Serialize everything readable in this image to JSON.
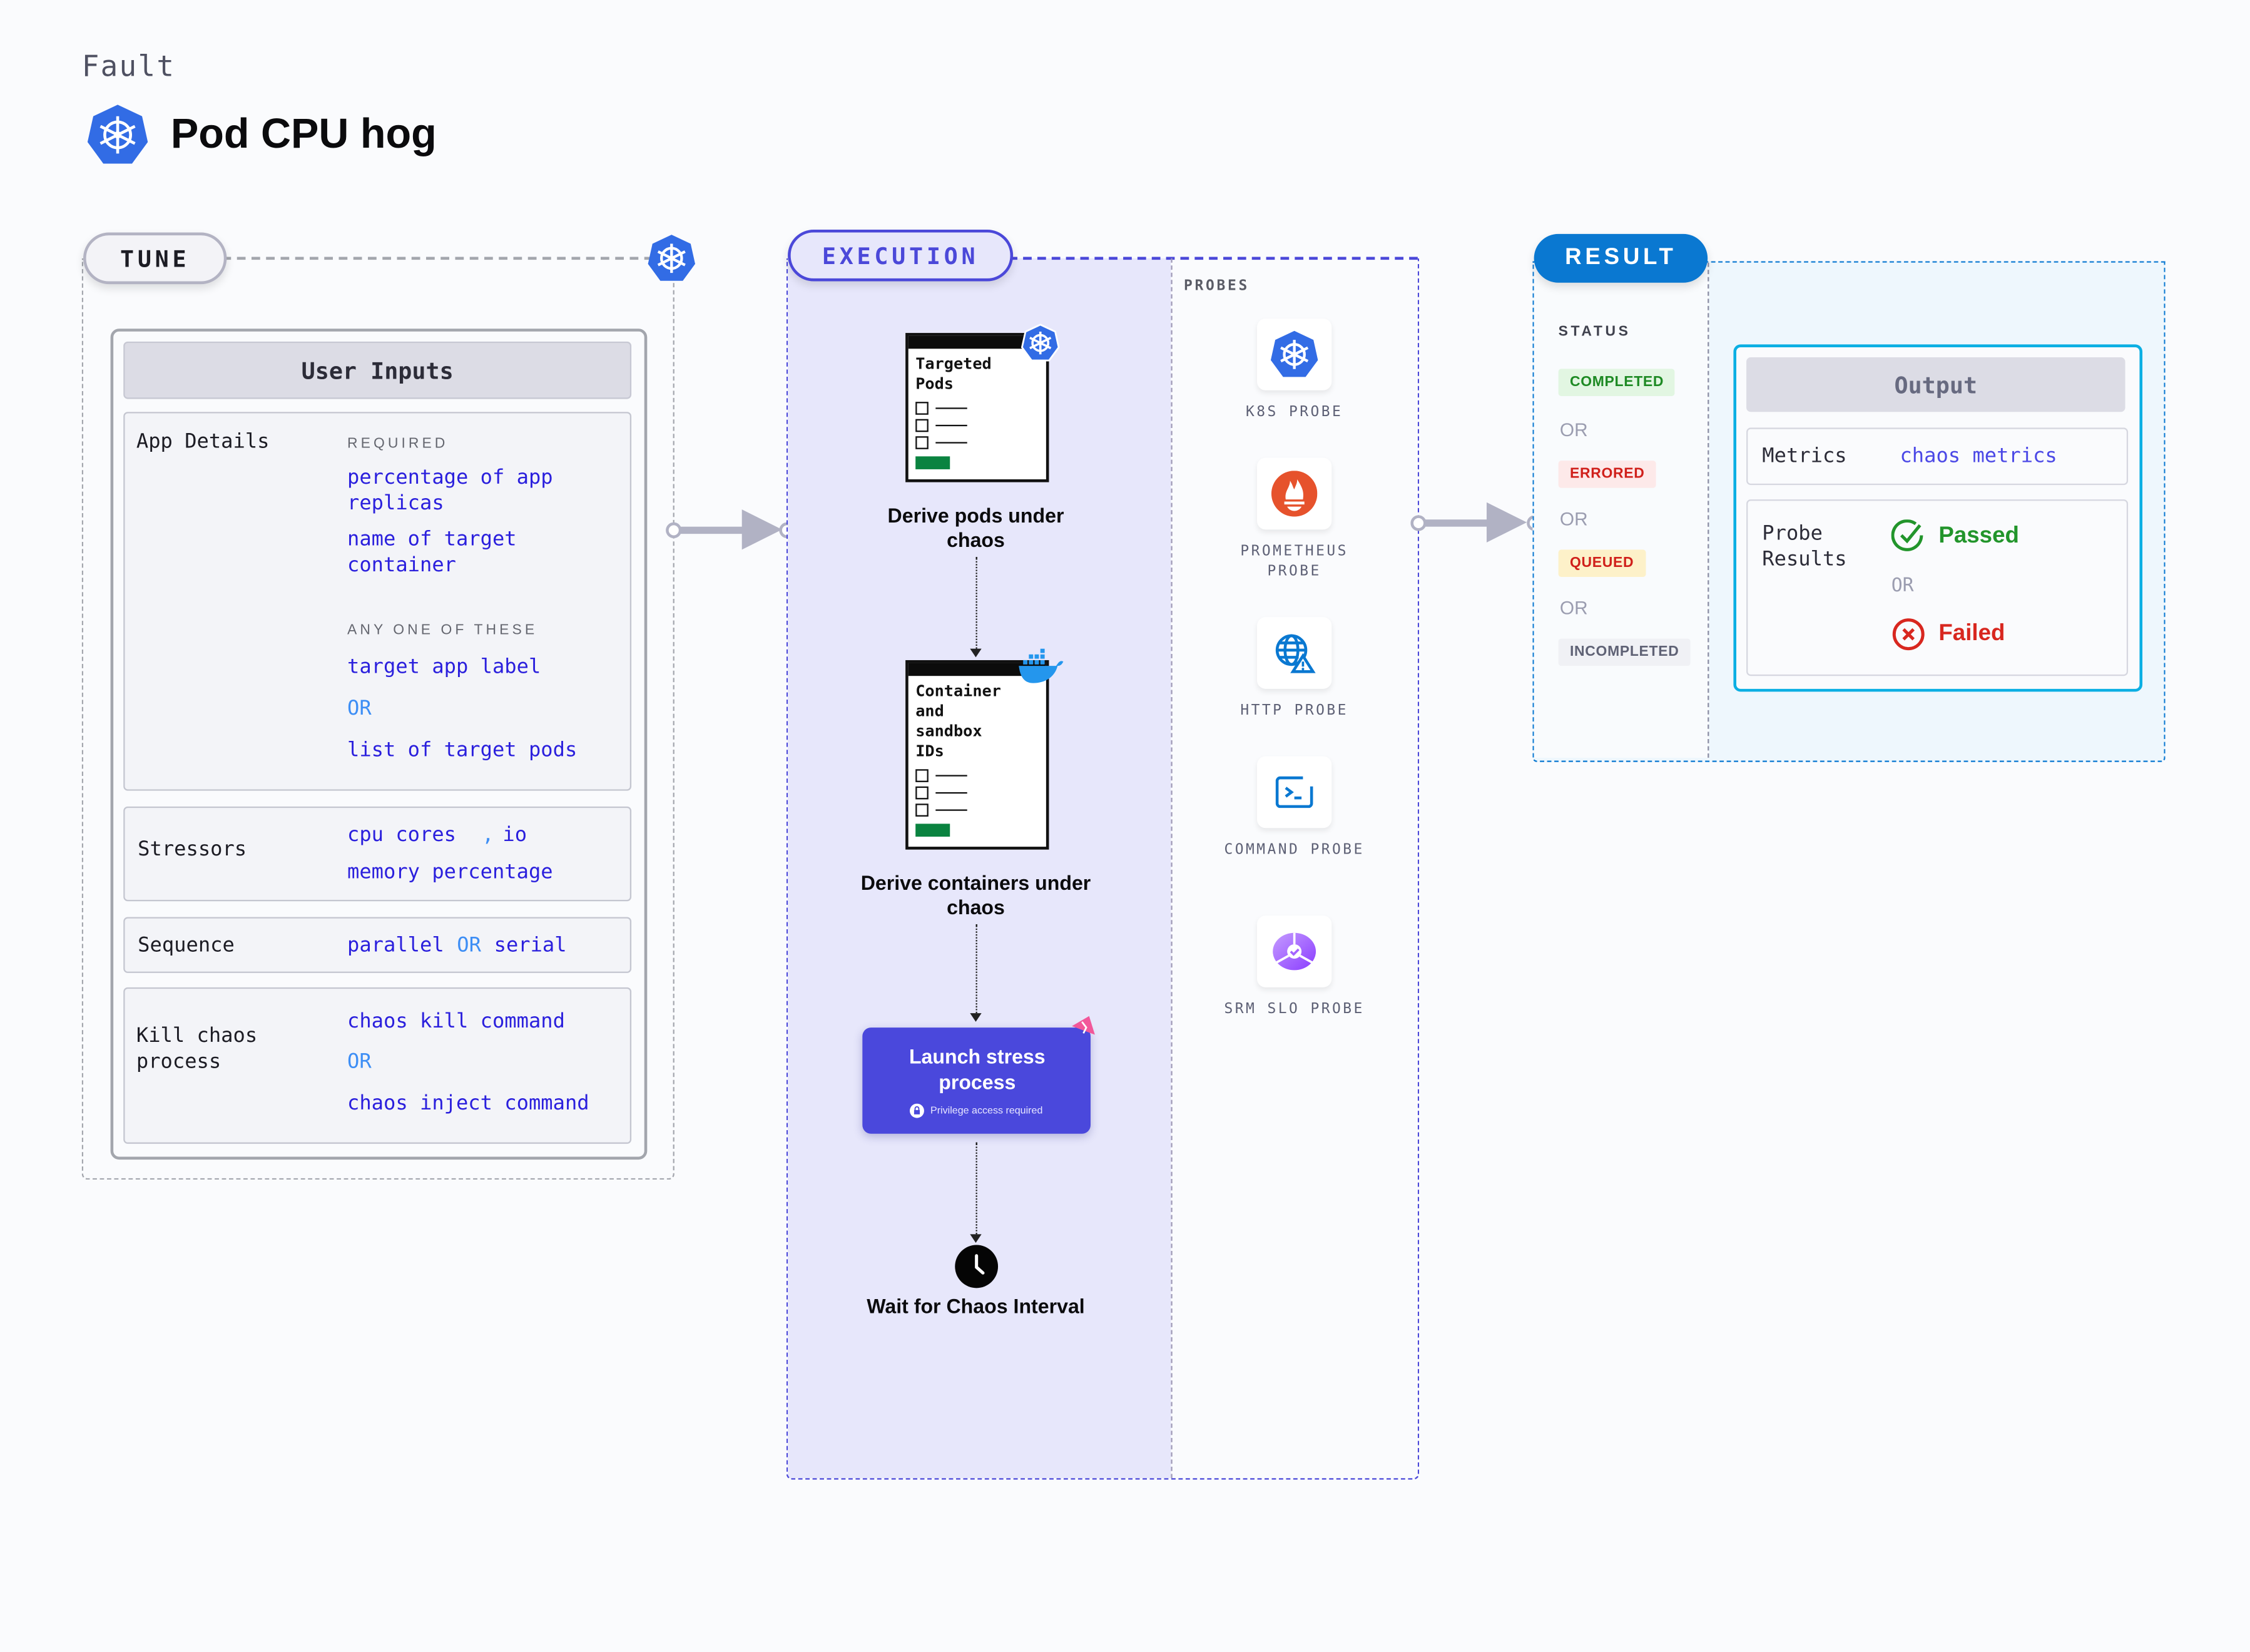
{
  "header": {
    "category": "Fault",
    "title": "Pod CPU hog",
    "title_icon": "kubernetes-icon"
  },
  "tune": {
    "label": "TUNE",
    "platform_icon": "kubernetes-icon",
    "user_inputs": {
      "title": "User Inputs",
      "app_details": {
        "label": "App Details",
        "required_caption": "REQUIRED",
        "required": [
          "percentage of app replicas",
          "name of target container"
        ],
        "any_one_caption": "ANY ONE OF THESE",
        "any_one": [
          "target app label",
          "list of target pods"
        ],
        "or": "OR"
      },
      "stressors": {
        "label": "Stressors",
        "values": [
          "cpu cores",
          "io",
          "memory percentage"
        ],
        "separator": ","
      },
      "sequence": {
        "label": "Sequence",
        "values": [
          "parallel",
          "serial"
        ],
        "or": "OR"
      },
      "kill_chaos": {
        "label": "Kill chaos process",
        "values": [
          "chaos kill command",
          "chaos inject command"
        ],
        "or": "OR"
      }
    }
  },
  "execution": {
    "label": "EXECUTION",
    "steps": [
      {
        "card_title": "Targeted Pods",
        "label": "Derive pods under chaos",
        "badge_icon": "kubernetes-icon"
      },
      {
        "card_title": "Container and sandbox IDs",
        "label": "Derive containers under chaos",
        "badge_icon": "docker-icon"
      },
      {
        "label": "Launch stress process",
        "note": "Privilege access required",
        "badge_icon": "chaos-icon"
      },
      {
        "label": "Wait for Chaos Interval",
        "icon": "clock-icon"
      }
    ],
    "probes": {
      "caption": "PROBES",
      "items": [
        {
          "name": "K8S PROBE",
          "icon": "kubernetes-icon"
        },
        {
          "name": "PROMETHEUS PROBE",
          "icon": "prometheus-icon"
        },
        {
          "name": "HTTP PROBE",
          "icon": "http-globe-icon"
        },
        {
          "name": "COMMAND PROBE",
          "icon": "terminal-icon"
        },
        {
          "name": "SRM SLO PROBE",
          "icon": "slo-icon"
        }
      ]
    }
  },
  "result": {
    "label": "RESULT",
    "status_caption": "STATUS",
    "statuses": [
      {
        "label": "COMPLETED",
        "fg": "#1e8a24",
        "bg": "#e2f6e2"
      },
      {
        "label": "ERRORED",
        "fg": "#d0201b",
        "bg": "#fde9e9"
      },
      {
        "label": "QUEUED",
        "fg": "#d0201b",
        "bg": "#fdf1c9"
      },
      {
        "label": "INCOMPLETED",
        "fg": "#5f6275",
        "bg": "#f0f1f5"
      }
    ],
    "or": "OR",
    "output": {
      "title": "Output",
      "metrics_label": "Metrics",
      "metrics_value": "chaos metrics",
      "probe_results_label": "Probe Results",
      "passed": "Passed",
      "failed": "Failed",
      "or": "OR"
    }
  },
  "colors": {
    "kubernetes": "#326ce5",
    "execution_accent": "#4b48d9",
    "result_accent": "#0a78d1",
    "value_text": "#2a1fdd",
    "passed": "#22952b",
    "failed": "#d8271f"
  }
}
